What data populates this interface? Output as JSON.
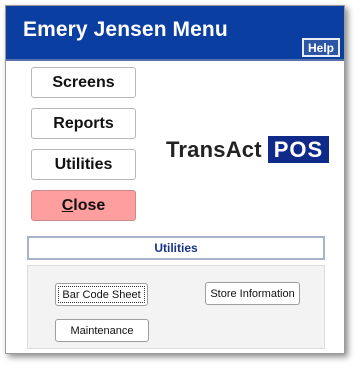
{
  "window": {
    "title": "Emery Jensen Menu",
    "help_label": "Help"
  },
  "menu": {
    "screens_label": "Screens",
    "reports_label": "Reports",
    "utilities_label": "Utilities",
    "close_label": "Close",
    "close_accel_letter": "C",
    "close_rest": "lose"
  },
  "logo": {
    "text": "TransAct",
    "badge": "POS"
  },
  "section": {
    "title": "Utilities",
    "buttons": {
      "bar_code_sheet": "Bar Code Sheet",
      "store_information": "Store Information",
      "maintenance": "Maintenance"
    }
  },
  "colors": {
    "titlebar": "#0a3ea0",
    "close_button": "#ff9e9e",
    "pos_badge": "#102a8a",
    "section_title": "#18338a"
  }
}
